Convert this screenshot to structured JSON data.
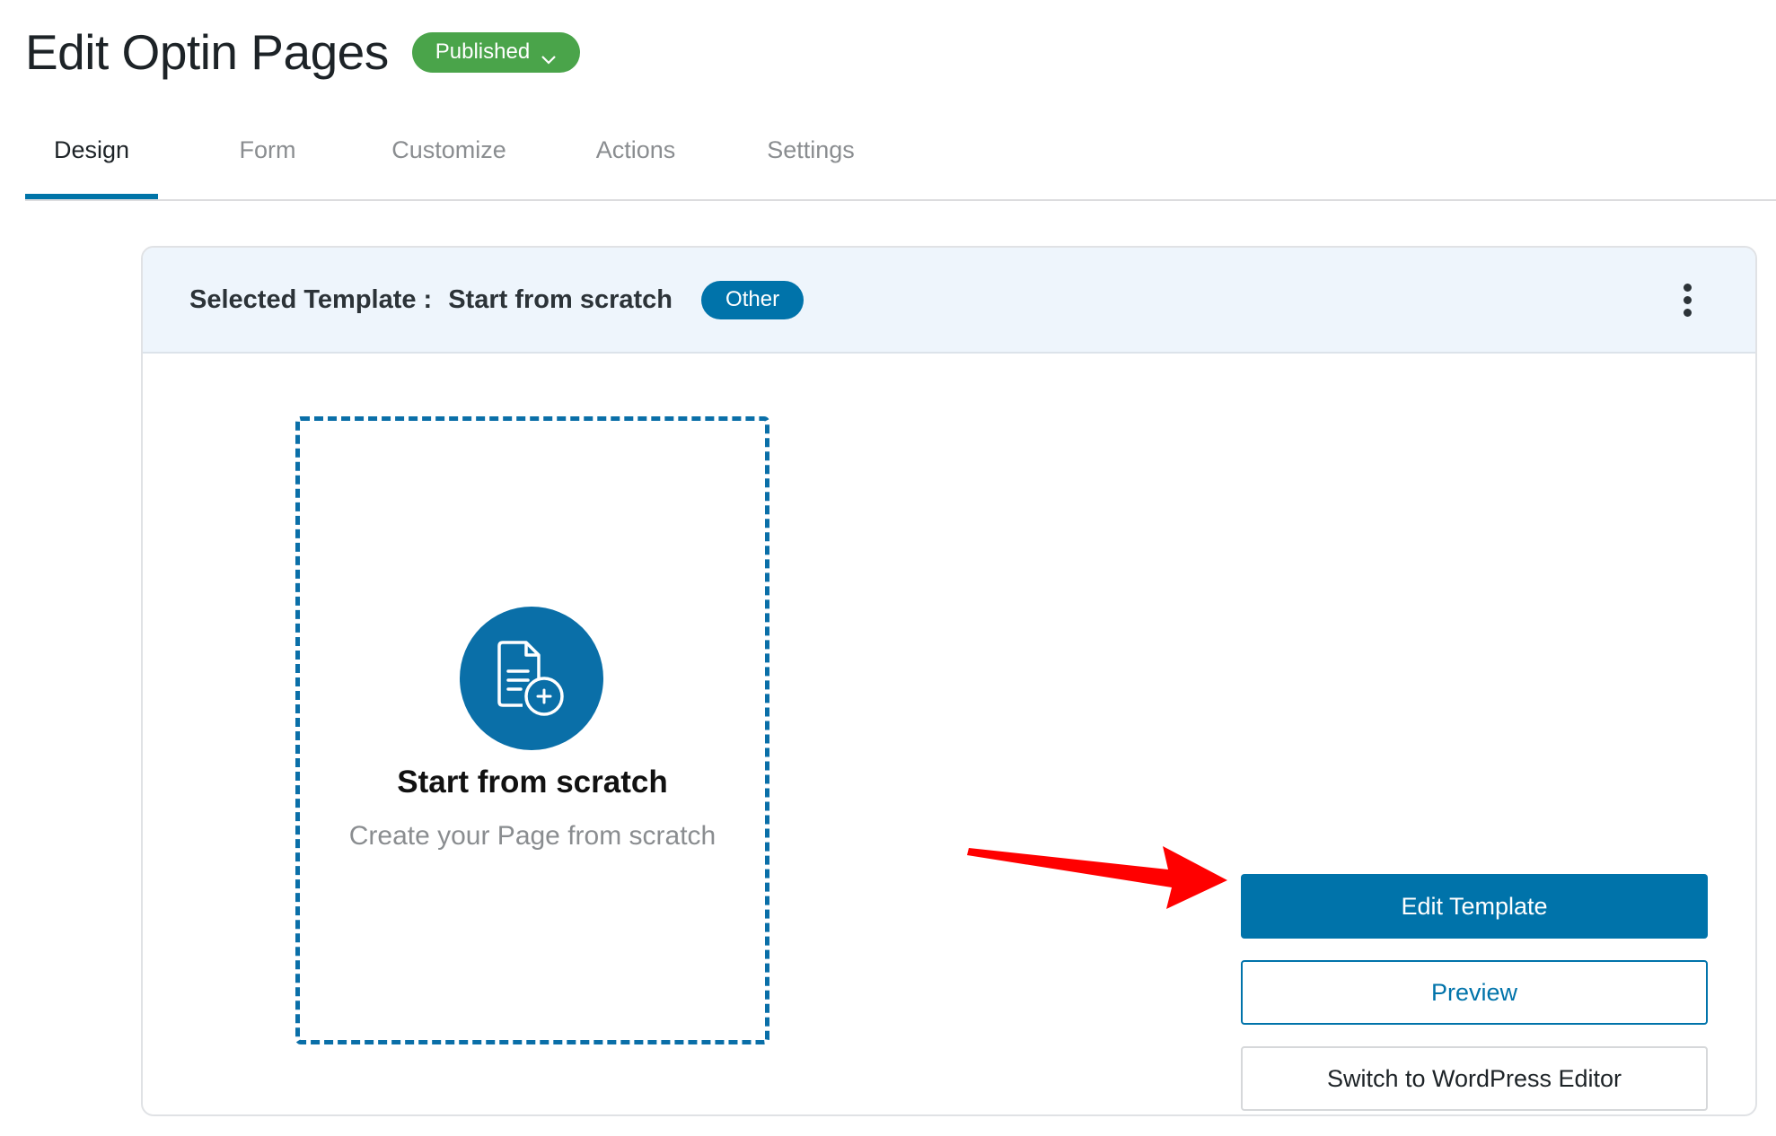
{
  "header": {
    "title": "Edit Optin Pages",
    "status_label": "Published"
  },
  "tabs": [
    {
      "label": "Design",
      "active": true
    },
    {
      "label": "Form",
      "active": false
    },
    {
      "label": "Customize",
      "active": false
    },
    {
      "label": "Actions",
      "active": false
    },
    {
      "label": "Settings",
      "active": false
    }
  ],
  "template_card": {
    "selected_label": "Selected Template :",
    "template_name": "Start from scratch",
    "category_badge": "Other",
    "menu_icon": "more-vertical-icon"
  },
  "scratch": {
    "icon": "document-plus-icon",
    "title": "Start from scratch",
    "subtitle": "Create your Page from scratch"
  },
  "actions": {
    "edit_template": "Edit Template",
    "preview": "Preview",
    "switch_editor": "Switch to WordPress Editor"
  },
  "annotation": {
    "arrow_icon": "red-arrow-icon"
  },
  "colors": {
    "primary": "#0073aa",
    "published": "#4aa44a",
    "card_header_bg": "#eef5fc",
    "annotation_arrow": "#ff0000"
  }
}
